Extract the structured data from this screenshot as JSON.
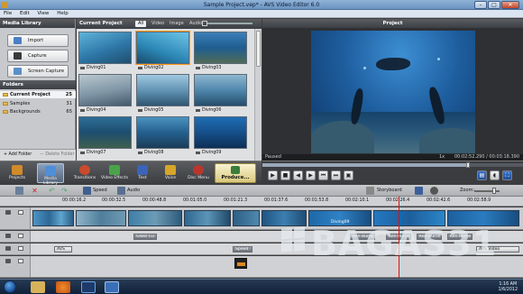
{
  "window": {
    "title": "Sample Project.vep* - AVS Video Editor 6.0",
    "controls": [
      "–",
      "□",
      "✕"
    ]
  },
  "menu": [
    "File",
    "Edit",
    "View",
    "Help"
  ],
  "left_panel": {
    "title": "Media Library",
    "buttons": [
      "Import",
      "Capture",
      "Screen Capture"
    ],
    "folders_title": "Folders",
    "folders": [
      {
        "name": "Current Project",
        "count": "25"
      },
      {
        "name": "Samples",
        "count": "31"
      },
      {
        "name": "Backgrounds",
        "count": "65"
      }
    ],
    "add_folder": "+ Add Folder",
    "delete_folder": "— Delete Folder"
  },
  "media": {
    "title": "Current Project",
    "filters": [
      "All",
      "Video",
      "Image",
      "Audio"
    ],
    "items": [
      "Diving01",
      "Diving02",
      "Diving03",
      "Diving04",
      "Diving05",
      "Diving06",
      "Diving07",
      "Diving08",
      "Diving09"
    ]
  },
  "preview": {
    "title": "Project",
    "status": "Paused",
    "speed": "1x",
    "time": "00:02:52.290 / 00:03:18.390"
  },
  "tools": [
    {
      "label": "Projects",
      "color": "#d08b2a"
    },
    {
      "label": "Media Library",
      "color": "#4f8fd9"
    },
    {
      "label": "Transitions",
      "color": "#c94b2e"
    },
    {
      "label": "Video Effects",
      "color": "#4aa34a"
    },
    {
      "label": "Text",
      "color": "#3b63b8"
    },
    {
      "label": "Voice",
      "color": "#d6a62a"
    },
    {
      "label": "Disc Menu",
      "color": "#b8362c"
    }
  ],
  "produce_label": "Produce...",
  "timeline": {
    "speed_label": "Speed",
    "audio_label": "Audio",
    "view_label": "Storyboard",
    "zoom_label": "Zoom:",
    "ruler": [
      "00:00:16.2",
      "00:00:32.5",
      "00:00:48.8",
      "00:01:05.0",
      "00:01:21.3",
      "00:01:37.6",
      "00:01:53.8",
      "00:02:10.1",
      "00:02:26.4",
      "00:02:42.6",
      "00:02:58.9"
    ],
    "video_clip_labels": [
      "Diving01",
      "Diving09"
    ],
    "effect_labels": [
      "Glass Cu",
      "Ken Burns",
      "Ken Burns",
      "Ken Burns",
      "Ken Burns"
    ],
    "text_labels": [
      "AVS",
      "Speed",
      "AVS Video"
    ]
  },
  "taskbar": {
    "time": "1:16 AM",
    "date": "1/6/2012"
  },
  "watermark": "BAGAS31"
}
